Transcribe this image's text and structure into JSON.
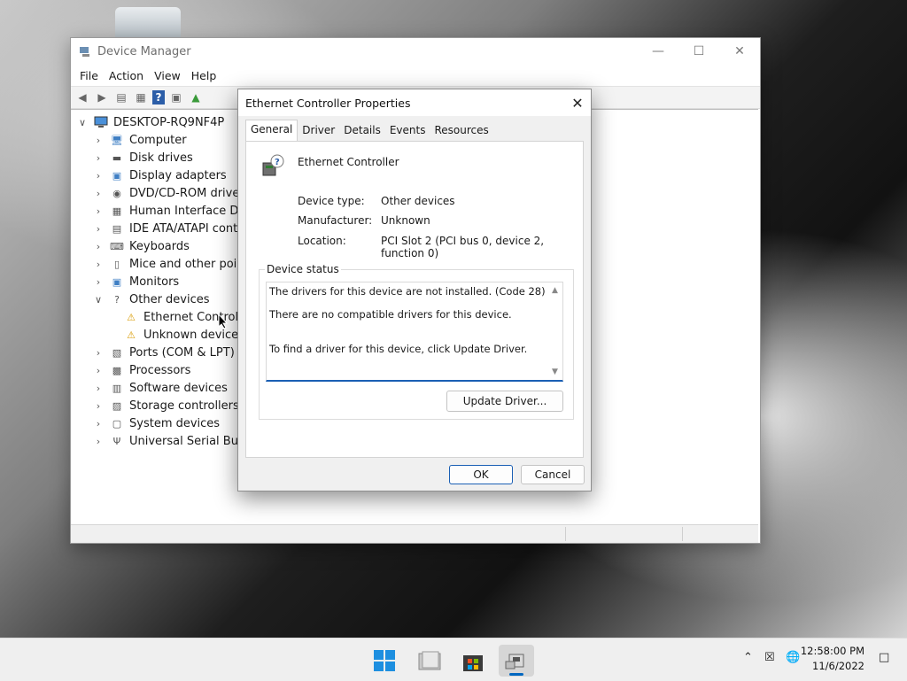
{
  "device_manager": {
    "title": "Device Manager",
    "menu": [
      "File",
      "Action",
      "View",
      "Help"
    ],
    "root": "DESKTOP-RQ9NF4P",
    "tree": [
      {
        "label": "Computer",
        "icon": "computer-icon",
        "expanded": false,
        "level": 1
      },
      {
        "label": "Disk drives",
        "icon": "disk-drive-icon",
        "expanded": false,
        "level": 1
      },
      {
        "label": "Display adapters",
        "icon": "monitor-icon",
        "expanded": false,
        "level": 1
      },
      {
        "label": "DVD/CD-ROM drives",
        "icon": "dvd-drive-icon",
        "expanded": false,
        "level": 1
      },
      {
        "label": "Human Interface Devic",
        "icon": "hid-icon",
        "expanded": false,
        "level": 1
      },
      {
        "label": "IDE ATA/ATAPI controll",
        "icon": "ide-controller-icon",
        "expanded": false,
        "level": 1
      },
      {
        "label": "Keyboards",
        "icon": "keyboard-icon",
        "expanded": false,
        "level": 1
      },
      {
        "label": "Mice and other pointi",
        "icon": "mouse-icon",
        "expanded": false,
        "level": 1
      },
      {
        "label": "Monitors",
        "icon": "monitor-icon",
        "expanded": false,
        "level": 1
      },
      {
        "label": "Other devices",
        "icon": "unknown-device-icon",
        "expanded": true,
        "level": 1
      },
      {
        "label": "Ethernet Controlle",
        "icon": "warning-device-icon",
        "level": 2
      },
      {
        "label": "Unknown device",
        "icon": "warning-device-icon",
        "level": 2
      },
      {
        "label": "Ports (COM & LPT)",
        "icon": "port-icon",
        "expanded": false,
        "level": 1
      },
      {
        "label": "Processors",
        "icon": "processor-icon",
        "expanded": false,
        "level": 1
      },
      {
        "label": "Software devices",
        "icon": "software-device-icon",
        "expanded": false,
        "level": 1
      },
      {
        "label": "Storage controllers",
        "icon": "storage-controller-icon",
        "expanded": false,
        "level": 1
      },
      {
        "label": "System devices",
        "icon": "system-device-icon",
        "expanded": false,
        "level": 1
      },
      {
        "label": "Universal Serial Bus co",
        "icon": "usb-icon",
        "expanded": false,
        "level": 1
      }
    ]
  },
  "dialog": {
    "title": "Ethernet Controller Properties",
    "tabs": [
      "General",
      "Driver",
      "Details",
      "Events",
      "Resources"
    ],
    "active_tab": "General",
    "device_name": "Ethernet Controller",
    "props": {
      "type_label": "Device type:",
      "type_value": "Other devices",
      "mfr_label": "Manufacturer:",
      "mfr_value": "Unknown",
      "loc_label": "Location:",
      "loc_value": "PCI Slot 2 (PCI bus 0, device 2, function 0)"
    },
    "status_legend": "Device status",
    "status_lines": [
      "The drivers for this device are not installed. (Code 28)",
      "There are no compatible drivers for this device.",
      "To find a driver for this device, click Update Driver."
    ],
    "update_button": "Update Driver...",
    "ok_button": "OK",
    "cancel_button": "Cancel"
  },
  "taskbar": {
    "time": "12:58:00 PM",
    "date": "11/6/2022"
  },
  "colors": {
    "accent": "#0067c0",
    "focus_blue": "#1a5fb4",
    "warning": "#f2b705"
  }
}
